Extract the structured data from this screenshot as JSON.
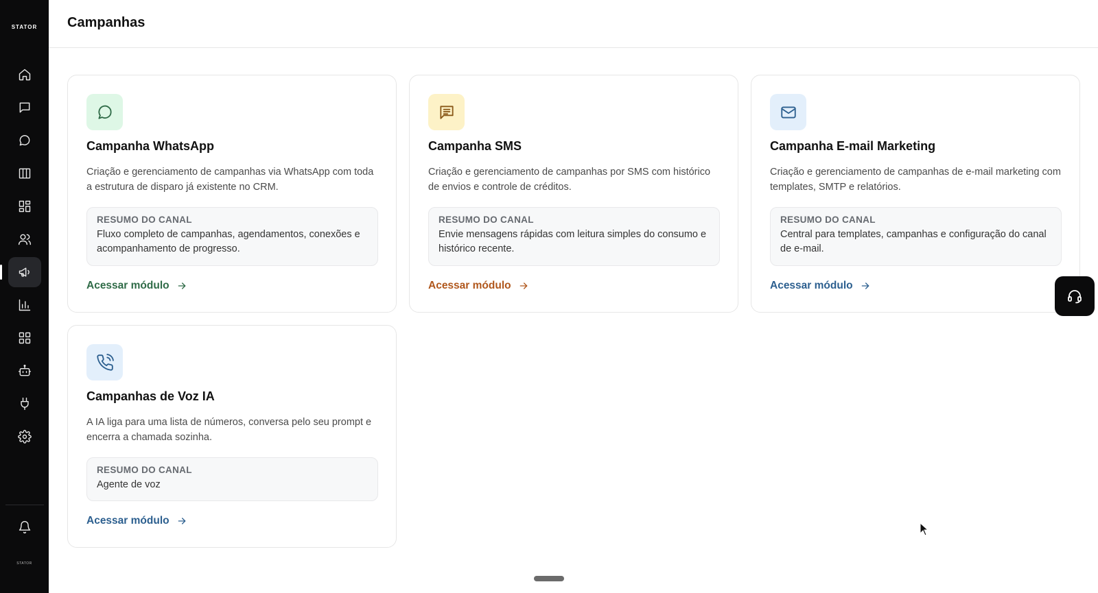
{
  "app": {
    "brand": "STATOR",
    "brand_small": "STATOR"
  },
  "header": {
    "title": "Campanhas"
  },
  "sidebar": {
    "items": [
      {
        "icon": "home-icon",
        "name": "sidebar-item-home",
        "active": false
      },
      {
        "icon": "message-square-icon",
        "name": "sidebar-item-inbox",
        "active": false
      },
      {
        "icon": "message-circle-icon",
        "name": "sidebar-item-chat",
        "active": false
      },
      {
        "icon": "columns-icon",
        "name": "sidebar-item-kanban",
        "active": false
      },
      {
        "icon": "dashboard-icon",
        "name": "sidebar-item-dashboard",
        "active": false
      },
      {
        "icon": "users-icon",
        "name": "sidebar-item-contacts",
        "active": false
      },
      {
        "icon": "megaphone-icon",
        "name": "sidebar-item-campaigns",
        "active": true
      },
      {
        "icon": "bar-chart-icon",
        "name": "sidebar-item-reports",
        "active": false
      },
      {
        "icon": "grid-icon",
        "name": "sidebar-item-apps",
        "active": false
      },
      {
        "icon": "bot-icon",
        "name": "sidebar-item-bots",
        "active": false
      },
      {
        "icon": "plug-icon",
        "name": "sidebar-item-integrations",
        "active": false
      },
      {
        "icon": "gear-icon",
        "name": "sidebar-item-settings",
        "active": false
      }
    ],
    "bottom_icon": "bell-icon"
  },
  "cards": [
    {
      "title": "Campanha WhatsApp",
      "description": "Criação e gerenciamento de campanhas via WhatsApp com toda a estrutura de disparo já existente no CRM.",
      "summary_label": "RESUMO DO CANAL",
      "summary_text": "Fluxo completo de campanhas, agendamentos, conexões e acompanhamento de progresso.",
      "link": "Acessar módulo",
      "icon": "whatsapp-icon",
      "accent": "#2f6b47",
      "icon_bg": "#def7e6",
      "icon_color": "#2f6b47"
    },
    {
      "title": "Campanha SMS",
      "description": "Criação e gerenciamento de campanhas por SMS com histórico de envios e controle de créditos.",
      "summary_label": "RESUMO DO CANAL",
      "summary_text": "Envie mensagens rápidas com leitura simples do consumo e histórico recente.",
      "link": "Acessar módulo",
      "icon": "sms-icon",
      "accent": "#b0571c",
      "icon_bg": "#fdf2c7",
      "icon_color": "#8a5a1a"
    },
    {
      "title": "Campanha E-mail Marketing",
      "description": "Criação e gerenciamento de campanhas de e-mail marketing com templates, SMTP e relatórios.",
      "summary_label": "RESUMO DO CANAL",
      "summary_text": "Central para templates, campanhas e configuração do canal de e-mail.",
      "link": "Acessar módulo",
      "icon": "mail-icon",
      "accent": "#2c5f8f",
      "icon_bg": "#e3effb",
      "icon_color": "#2c5f8f"
    },
    {
      "title": "Campanhas de Voz IA",
      "description": "A IA liga para uma lista de números, conversa pelo seu prompt e encerra a chamada sozinha.",
      "summary_label": "RESUMO DO CANAL",
      "summary_text": "Agente de voz",
      "link": "Acessar módulo",
      "icon": "phone-call-icon",
      "accent": "#2c5f8f",
      "icon_bg": "#e3effb",
      "icon_color": "#2c5f8f"
    }
  ],
  "fab": {
    "icon": "headset-icon"
  }
}
